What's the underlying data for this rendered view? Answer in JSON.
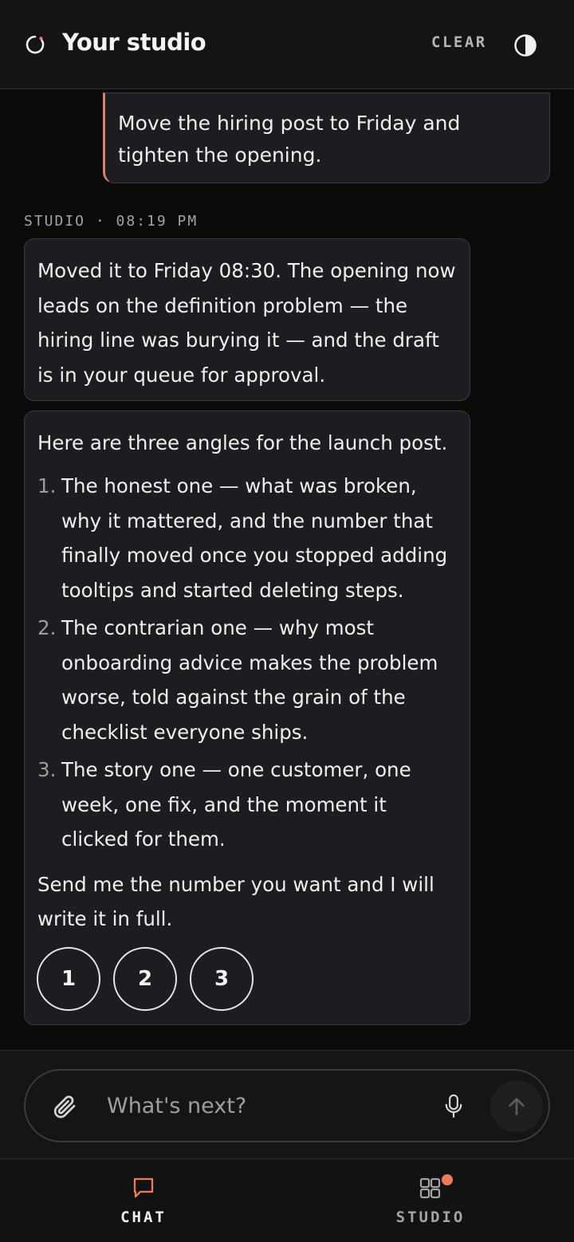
{
  "header": {
    "title": "Your studio",
    "clear_label": "CLEAR",
    "logo_icon": "loading-ring-icon",
    "theme_icon": "contrast-icon"
  },
  "messages": {
    "user": {
      "text": "Move the hiring post to Friday and tighten the opening."
    },
    "meta": "STUDIO · 08:19 PM",
    "assistant_1": {
      "text": "Moved it to Friday 08:30. The opening now leads on the definition problem — the hiring line was burying it — and the draft is in your queue for approval."
    },
    "assistant_2": {
      "intro": "Here are three angles for the launch post.",
      "items": [
        {
          "num": "1.",
          "text": "The honest one — what was broken, why it mattered, and the number that finally moved once you stopped adding tooltips and started deleting steps."
        },
        {
          "num": "2.",
          "text": "The contrarian one — why most onboarding advice makes the problem worse, told against the grain of the checklist everyone ships."
        },
        {
          "num": "3.",
          "text": "The story one — one customer, one week, one fix, and the moment it clicked for them."
        }
      ],
      "outro": "Send me the number you want and I will write it in full.",
      "choices": [
        "1",
        "2",
        "3"
      ]
    }
  },
  "composer": {
    "placeholder": "What's next?",
    "attach_icon": "paperclip-icon",
    "mic_icon": "microphone-icon",
    "send_icon": "arrow-up-icon"
  },
  "nav": {
    "chat_label": "CHAT",
    "studio_label": "STUDIO"
  },
  "colors": {
    "accent": "#e2805a",
    "badge": "#ee7c59",
    "background": "#0b0b0c",
    "bubble": "#1d1d21"
  }
}
